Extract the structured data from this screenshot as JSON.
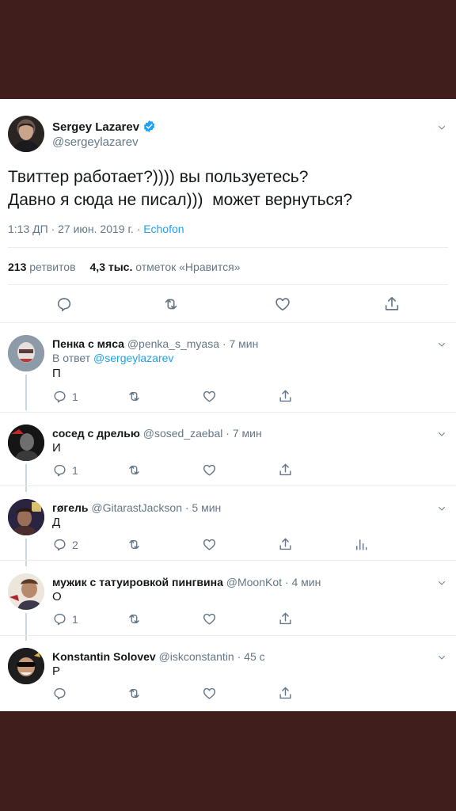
{
  "tweet": {
    "name": "Sergey Lazarev",
    "handle": "@sergeylazarev",
    "text_line1": "Твиттер работает?)))) вы пользуетесь?",
    "text_line2": "Давно я сюда не писал)))  может вернуться?",
    "time": "1:13 ДП · 27 июн. 2019 г. · ",
    "source": "Echofon",
    "retweets_count": "213",
    "retweets_label": "ретвитов",
    "likes_count": "4,3 тыс.",
    "likes_label": "отметок «Нравится»"
  },
  "replies": [
    {
      "name": "Пенка с мяса",
      "handle": "@penka_s_myasa",
      "time": " · 7 мин",
      "in_reply_prefix": "В ответ ",
      "in_reply_mention": "@sergeylazarev",
      "text": "П",
      "reply_count": "1"
    },
    {
      "name": "сосед с дрелью",
      "handle": "@sosed_zaebal",
      "time": " · 7 мин",
      "text": "И",
      "reply_count": "1"
    },
    {
      "name": "гøгель",
      "handle": "@GitarastJackson",
      "time": " · 5 мин",
      "text": "Д",
      "reply_count": "2"
    },
    {
      "name": "мужик с татуировкой пингвина",
      "handle": "@MoonKot",
      "time": " · 4 мин",
      "text": "О",
      "reply_count": "1"
    },
    {
      "name": "Konstantin Solovev",
      "handle": "@iskconstantin",
      "time": " · 45 с",
      "text": "Р",
      "reply_count": ""
    }
  ],
  "icons": {
    "reply": "reply-icon",
    "retweet": "retweet-icon",
    "like": "heart-icon",
    "share": "share-icon",
    "analytics": "analytics-icon",
    "caret": "chevron-down-icon",
    "verified": "verified-badge-icon"
  },
  "colors": {
    "background": "#3f1e1b",
    "card": "#ffffff",
    "accent": "#1da1f2",
    "secondary_text": "#657786"
  }
}
